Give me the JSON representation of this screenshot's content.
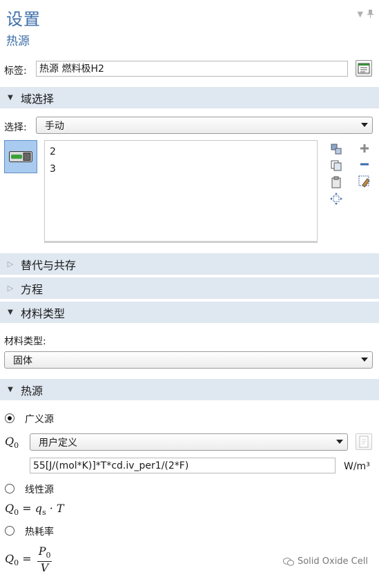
{
  "header": {
    "title": "设置",
    "subtitle": "热源"
  },
  "label_row": {
    "label": "标签:",
    "value": "热源 燃料极H2"
  },
  "sections": {
    "domain_selection": "域选择",
    "override": "替代与共存",
    "equation": "方程",
    "material_type": "材料类型",
    "heat_source": "热源"
  },
  "selection": {
    "label": "选择:",
    "value": "手动",
    "domains": [
      "2",
      "3"
    ]
  },
  "material": {
    "label": "材料类型:",
    "value": "固体"
  },
  "heat": {
    "general_label": "广义源",
    "q0_symbol": "Q",
    "q0_sub": "0",
    "q0_option": "用户定义",
    "q0_expression": "55[J/(mol*K)]*T*cd.iv_per1/(2*F)",
    "q0_unit": "W/m³",
    "linear_label": "线性源",
    "linear_formula": {
      "lhs": "Q",
      "lhs_sub": "0",
      "eq": " = ",
      "q": "q",
      "q_sub": "s",
      "dot": " · ",
      "t": "T"
    },
    "dissipation_label": "热耗率",
    "dissipation_formula": {
      "lhs": "Q",
      "lhs_sub": "0",
      "eq": " = ",
      "num": "P",
      "num_sub": "0",
      "den": "V"
    },
    "selected": "general"
  },
  "watermark": "Solid Oxide Cell",
  "colors": {
    "title": "#3c6eaa",
    "section_bg": "#dfe7f1",
    "toggle_bg": "#a9cbef"
  }
}
